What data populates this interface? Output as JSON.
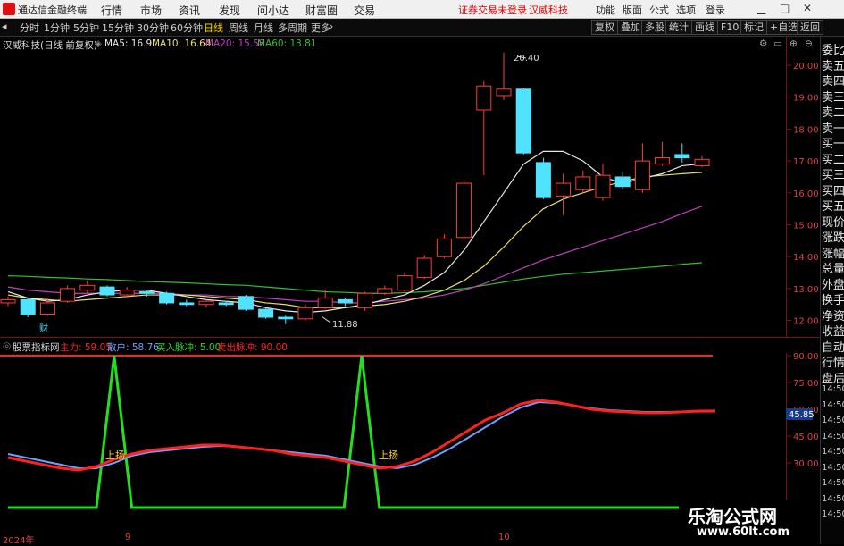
{
  "menubar": {
    "app_title": "通达信金融终端",
    "menus": [
      "行情",
      "市场",
      "资讯",
      "发现",
      "问小达",
      "财富圈",
      "交易"
    ],
    "notice": "证券交易未登录",
    "stock_name": "汉威科技",
    "right_menus": [
      "功能",
      "版面",
      "公式",
      "选项"
    ],
    "login": "登录"
  },
  "tabs": [
    "分时",
    "1分钟",
    "5分钟",
    "15分钟",
    "30分钟",
    "60分钟",
    "日线",
    "周线",
    "月线",
    "多周期",
    "更多"
  ],
  "active_tab": "日线",
  "toolbar": [
    "复权",
    "叠加",
    "多股",
    "统计",
    "画线",
    "F10",
    "标记",
    "+自选",
    "返回"
  ],
  "chart_info": {
    "title": "汉威科技(日线 前复权)",
    "ma5": "MA5: 16.91",
    "ma10": "MA10: 16.64",
    "ma20": "MA20: 15.58",
    "ma60": "MA60: 13.81"
  },
  "price_axis": [
    "20.00",
    "19.00",
    "18.00",
    "17.00",
    "16.00",
    "15.00",
    "14.00",
    "13.00",
    "12.00"
  ],
  "annotations": {
    "high": "20.40",
    "low": "11.88",
    "cai": "财"
  },
  "indicator": {
    "name": "股票指标网",
    "main": "主力: 59.05",
    "retail": "散户: 58.76",
    "buy": "买入脉冲: 5.00",
    "sell": "卖出脉冲: 90.00",
    "axis": [
      "90.00",
      "75.00",
      "60.00",
      "45.00",
      "30.00"
    ],
    "current": "45.85",
    "rise_label": "上扬"
  },
  "dates": {
    "start": "2024年",
    "m9": "9",
    "m10": "10"
  },
  "right_panel": [
    "委比",
    "卖五",
    "卖四",
    "卖三",
    "卖二",
    "卖一",
    "买一",
    "买二",
    "买三",
    "买四",
    "买五",
    "现价",
    "涨跌",
    "涨幅",
    "总量",
    "外盘",
    "换手",
    "净资",
    "收益",
    "自动",
    "行情",
    "盘后",
    "14:50",
    "14:50",
    "14:50",
    "14:50",
    "14:50",
    "14:50",
    "14:50",
    "14:50",
    "14:50"
  ],
  "watermark": {
    "line1": "乐淘公式网",
    "line2": "www.60lt.com"
  },
  "colors": {
    "up": "#ff3b3b",
    "down": "#4fe3ff",
    "ma5": "#e8e8e8",
    "ma10": "#e8e06a",
    "ma20": "#c040c0",
    "ma60": "#30c030",
    "main": "#ff2020",
    "retail": "#6fa0ff",
    "pulse": "#20e020"
  },
  "candles": [
    {
      "o": 12.55,
      "c": 12.65,
      "h": 12.75,
      "l": 12.45
    },
    {
      "o": 12.65,
      "c": 12.2,
      "h": 12.7,
      "l": 12.1
    },
    {
      "o": 12.2,
      "c": 12.55,
      "h": 12.7,
      "l": 12.15
    },
    {
      "o": 12.6,
      "c": 13.0,
      "h": 13.1,
      "l": 12.55
    },
    {
      "o": 12.95,
      "c": 13.1,
      "h": 13.25,
      "l": 12.85
    },
    {
      "o": 13.05,
      "c": 12.8,
      "h": 13.1,
      "l": 12.75
    },
    {
      "o": 12.8,
      "c": 12.95,
      "h": 13.05,
      "l": 12.7
    },
    {
      "o": 12.9,
      "c": 12.85,
      "h": 12.95,
      "l": 12.75
    },
    {
      "o": 12.85,
      "c": 12.55,
      "h": 12.9,
      "l": 12.5
    },
    {
      "o": 12.55,
      "c": 12.5,
      "h": 12.65,
      "l": 12.45
    },
    {
      "o": 12.5,
      "c": 12.6,
      "h": 12.65,
      "l": 12.4
    },
    {
      "o": 12.55,
      "c": 12.5,
      "h": 12.6,
      "l": 12.45
    },
    {
      "o": 12.75,
      "c": 12.35,
      "h": 12.8,
      "l": 12.3
    },
    {
      "o": 12.35,
      "c": 12.1,
      "h": 12.4,
      "l": 12.05
    },
    {
      "o": 12.1,
      "c": 12.05,
      "h": 12.15,
      "l": 11.88
    },
    {
      "o": 12.05,
      "c": 12.4,
      "h": 12.5,
      "l": 12.0
    },
    {
      "o": 12.4,
      "c": 12.7,
      "h": 12.95,
      "l": 12.35
    },
    {
      "o": 12.65,
      "c": 12.55,
      "h": 12.7,
      "l": 12.45
    },
    {
      "o": 12.4,
      "c": 12.85,
      "h": 12.9,
      "l": 12.3
    },
    {
      "o": 12.85,
      "c": 13.0,
      "h": 13.1,
      "l": 12.8
    },
    {
      "o": 12.95,
      "c": 13.4,
      "h": 13.5,
      "l": 12.9
    },
    {
      "o": 13.35,
      "c": 13.95,
      "h": 14.05,
      "l": 13.3
    },
    {
      "o": 14.0,
      "c": 14.55,
      "h": 14.7,
      "l": 13.95
    },
    {
      "o": 14.6,
      "c": 16.3,
      "h": 16.4,
      "l": 14.5
    },
    {
      "o": 18.6,
      "c": 19.35,
      "h": 19.5,
      "l": 16.55
    },
    {
      "o": 19.05,
      "c": 19.25,
      "h": 20.4,
      "l": 18.9
    },
    {
      "o": 19.25,
      "c": 17.25,
      "h": 19.3,
      "l": 17.2
    },
    {
      "o": 16.95,
      "c": 15.85,
      "h": 17.1,
      "l": 15.8
    },
    {
      "o": 15.9,
      "c": 16.3,
      "h": 16.6,
      "l": 15.3
    },
    {
      "o": 16.1,
      "c": 16.5,
      "h": 16.7,
      "l": 16.0
    },
    {
      "o": 15.85,
      "c": 16.55,
      "h": 16.9,
      "l": 15.75
    },
    {
      "o": 16.5,
      "c": 16.2,
      "h": 16.65,
      "l": 16.1
    },
    {
      "o": 16.1,
      "c": 17.0,
      "h": 17.55,
      "l": 16.0
    },
    {
      "o": 16.9,
      "c": 17.1,
      "h": 17.6,
      "l": 16.85
    },
    {
      "o": 17.2,
      "c": 17.1,
      "h": 17.55,
      "l": 16.95
    },
    {
      "o": 16.85,
      "c": 17.05,
      "h": 17.15,
      "l": 16.8
    }
  ],
  "ma5": [
    12.9,
    12.7,
    12.6,
    12.65,
    12.8,
    12.9,
    12.95,
    12.95,
    12.85,
    12.75,
    12.65,
    12.6,
    12.55,
    12.4,
    12.3,
    12.25,
    12.3,
    12.4,
    12.5,
    12.65,
    12.8,
    13.1,
    13.5,
    14.2,
    15.1,
    16.0,
    16.9,
    17.3,
    17.3,
    17.0,
    16.5,
    16.3,
    16.45,
    16.6,
    16.85,
    16.91
  ],
  "ma10": [
    12.8,
    12.7,
    12.65,
    12.6,
    12.65,
    12.7,
    12.75,
    12.8,
    12.8,
    12.8,
    12.75,
    12.7,
    12.65,
    12.55,
    12.5,
    12.4,
    12.4,
    12.4,
    12.45,
    12.5,
    12.6,
    12.75,
    12.95,
    13.25,
    13.7,
    14.3,
    14.95,
    15.5,
    15.8,
    16.0,
    16.2,
    16.35,
    16.5,
    16.55,
    16.6,
    16.64
  ],
  "ma20": [
    13.05,
    12.95,
    12.9,
    12.85,
    12.85,
    12.85,
    12.85,
    12.85,
    12.85,
    12.8,
    12.8,
    12.75,
    12.75,
    12.7,
    12.65,
    12.6,
    12.6,
    12.55,
    12.55,
    12.6,
    12.65,
    12.7,
    12.8,
    12.95,
    13.15,
    13.4,
    13.65,
    13.9,
    14.1,
    14.3,
    14.5,
    14.7,
    14.9,
    15.1,
    15.35,
    15.58
  ],
  "ma60": [
    13.4,
    13.38,
    13.35,
    13.33,
    13.3,
    13.28,
    13.25,
    13.22,
    13.2,
    13.18,
    13.15,
    13.12,
    13.1,
    13.05,
    13.0,
    12.95,
    12.9,
    12.88,
    12.85,
    12.85,
    12.87,
    12.9,
    12.95,
    13.0,
    13.1,
    13.2,
    13.3,
    13.38,
    13.45,
    13.5,
    13.55,
    13.6,
    13.65,
    13.7,
    13.76,
    13.81
  ],
  "main_line": [
    33,
    31,
    29,
    27,
    26,
    28,
    32,
    35,
    37,
    38,
    39,
    40,
    40,
    39,
    38,
    37,
    35,
    34,
    33,
    31,
    29,
    27,
    28,
    31,
    36,
    42,
    48,
    54,
    58,
    63,
    65,
    64,
    62,
    60,
    59,
    58.5,
    58,
    58,
    58.5,
    59,
    59.05
  ],
  "retail_line": [
    35,
    33,
    31,
    29,
    27,
    27,
    30,
    34,
    36,
    37,
    38,
    39,
    39.5,
    39,
    38,
    37,
    36,
    35,
    34,
    32,
    30,
    28,
    27,
    29,
    33,
    38,
    44,
    50,
    56,
    61,
    64,
    63.5,
    62,
    60.5,
    59.5,
    59,
    58.5,
    58.5,
    58.6,
    58.7,
    58.76
  ],
  "pulse_line": [
    5,
    5,
    5,
    5,
    5,
    5,
    90,
    5,
    5,
    5,
    5,
    5,
    5,
    5,
    5,
    5,
    5,
    5,
    5,
    5,
    90,
    5,
    5,
    5,
    5,
    5,
    5,
    5,
    5,
    5,
    5,
    5,
    5,
    5,
    5,
    5,
    5,
    5,
    5,
    5,
    5
  ]
}
